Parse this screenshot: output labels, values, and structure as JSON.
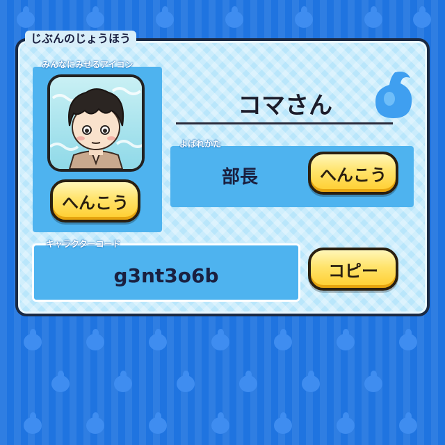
{
  "panel": {
    "title": "じぶんのじょうほう"
  },
  "icon_section": {
    "label": "みんなにみせるアイコン",
    "change_button": "へんこう"
  },
  "profile": {
    "name": "コマさん",
    "title_label": "よばれかた",
    "title_value": "部長",
    "change_button": "へんこう"
  },
  "character_code": {
    "label": "キャラクターコード",
    "value": "g3nt3o6b",
    "copy_button": "コピー"
  },
  "colors": {
    "background": "#1f74e0",
    "panel": "#b9e6fb",
    "section": "#4eb3ef",
    "button": "#ffd84a"
  },
  "icons": [
    "avatar-icon",
    "spirit-flame-icon"
  ]
}
